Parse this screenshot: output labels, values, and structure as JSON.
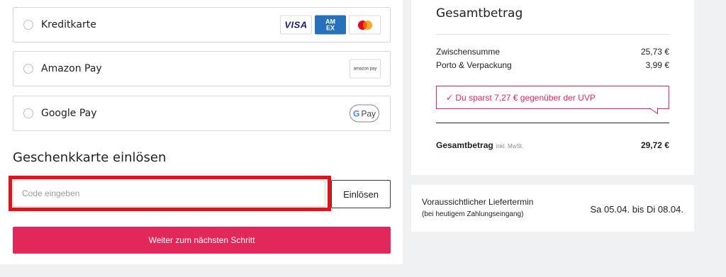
{
  "payment": {
    "options": [
      {
        "label": "Kreditkarte"
      },
      {
        "label": "Amazon Pay"
      },
      {
        "label": "Google Pay"
      }
    ],
    "logos": {
      "visa": "VISA",
      "amex_line1": "AM",
      "amex_line2": "EX",
      "amazon": "amazon pay",
      "gpay_g": "G",
      "gpay_text": "Pay"
    }
  },
  "gift_card": {
    "title": "Geschenkkarte einlösen",
    "input_placeholder": "Code eingeben",
    "input_value": "",
    "redeem_label": "Einlösen"
  },
  "next_button": "Weiter zum nächsten Schritt",
  "summary": {
    "title": "Gesamtbetrag",
    "subtotal_label": "Zwischensumme",
    "subtotal_value": "25,73 €",
    "shipping_label": "Porto & Verpackung",
    "shipping_value": "3,99 €",
    "savings_text": "✓ Du sparst 7,27 € gegenüber der UVP",
    "total_label": "Gesamtbetrag",
    "total_note": "inkl. MwSt.",
    "total_value": "29,72 €"
  },
  "delivery": {
    "label": "Voraussichtlicher Liefertermin",
    "sub": "(bei heutigem Zahlungseingang)",
    "date": "Sa 05.04. bis Di 08.04."
  },
  "colors": {
    "accent": "#e2285a",
    "highlight": "#e2111a",
    "amex_blue": "#2671b9"
  }
}
